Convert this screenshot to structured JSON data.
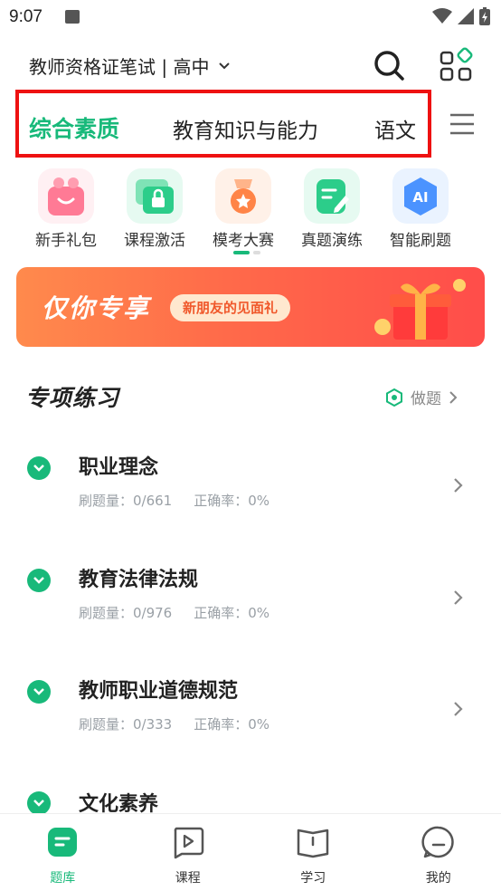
{
  "status_bar": {
    "time": "9:07"
  },
  "header": {
    "exam_selector": "教师资格证笔试 | 高中"
  },
  "subject_tabs": [
    {
      "label": "综合素质",
      "active": true
    },
    {
      "label": "教育知识与能力",
      "active": false
    },
    {
      "label": "语文",
      "active": false
    }
  ],
  "quick_actions": [
    {
      "label": "新手礼包",
      "icon": "gift-icon"
    },
    {
      "label": "课程激活",
      "icon": "lock-card-icon"
    },
    {
      "label": "模考大赛",
      "icon": "medal-icon"
    },
    {
      "label": "真题演练",
      "icon": "pen-note-icon"
    },
    {
      "label": "智能刷题",
      "icon": "ai-icon"
    }
  ],
  "banner": {
    "title": "仅你专享",
    "pill": "新朋友的见面礼"
  },
  "section": {
    "title": "专项练习",
    "action": "做题"
  },
  "practice_items": [
    {
      "title": "职业理念",
      "count_label": "刷题量：0/661",
      "accuracy_label": "正确率：0%"
    },
    {
      "title": "教育法律法规",
      "count_label": "刷题量：0/976",
      "accuracy_label": "正确率：0%"
    },
    {
      "title": "教师职业道德规范",
      "count_label": "刷题量：0/333",
      "accuracy_label": "正确率：0%"
    },
    {
      "title": "文化素养",
      "count_label": "",
      "accuracy_label": ""
    }
  ],
  "bottom_nav": [
    {
      "label": "题库",
      "active": true
    },
    {
      "label": "课程",
      "active": false
    },
    {
      "label": "学习",
      "active": false
    },
    {
      "label": "我的",
      "active": false
    }
  ],
  "colors": {
    "accent": "#18b97a",
    "highlight_border": "#ee1111",
    "banner": "#ff6a4a"
  }
}
